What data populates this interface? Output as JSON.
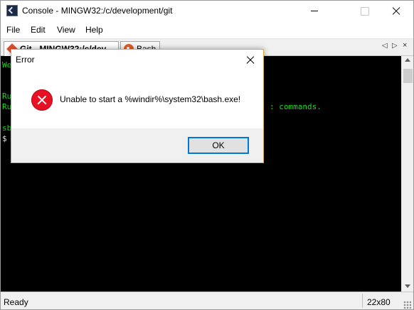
{
  "window": {
    "title": "Console - MINGW32:/c/development/git",
    "app_icon": "console-app-icon"
  },
  "menu": {
    "items": [
      "File",
      "Edit",
      "View",
      "Help"
    ]
  },
  "tabs": [
    {
      "label": "Git - MINGW32:/c/dev",
      "icon": "git-icon",
      "active": true
    },
    {
      "label": "Bash",
      "icon": "bash-icon",
      "active": false
    }
  ],
  "tab_nav": {
    "left": "◁",
    "right": "▷",
    "close": "×"
  },
  "console": {
    "lines": [
      "We",
      "Ru",
      "Ru",
      "sb",
      "$ "
    ],
    "tail_text": ": commands.",
    "text_color": "#1ed81e",
    "background": "#000000"
  },
  "status": {
    "left": "Ready",
    "right": "22x80"
  },
  "dialog": {
    "title": "Error",
    "message": "Unable to start a %windir%\\system32\\bash.exe!",
    "icon": "error-icon",
    "ok_label": "OK",
    "border_color": "#d8a93c",
    "accent": "#0078d7"
  }
}
